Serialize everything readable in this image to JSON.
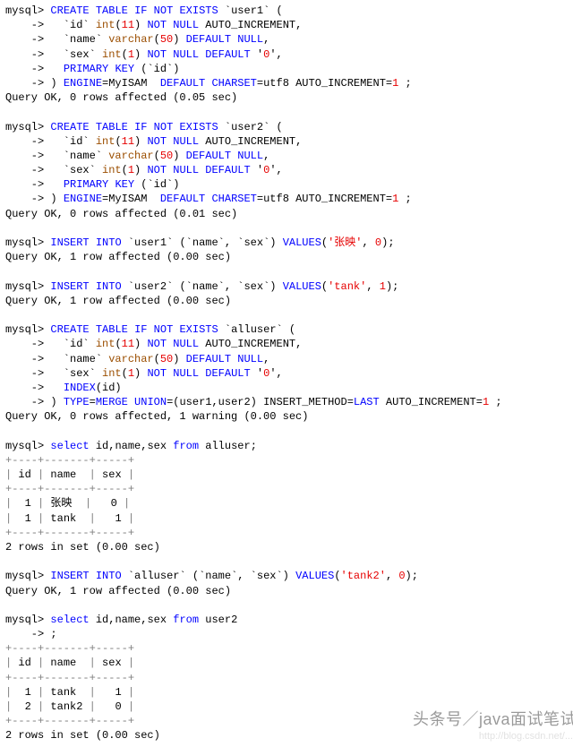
{
  "blocks": [
    {
      "id": "create_user1",
      "lines": [
        [
          "mysql> ",
          [
            "kw-blue",
            "CREATE"
          ],
          " ",
          [
            "kw-blue",
            "TABLE"
          ],
          " ",
          [
            "kw-blue",
            "IF"
          ],
          " ",
          [
            "kw-blue",
            "NOT"
          ],
          " ",
          [
            "kw-blue",
            "EXISTS"
          ],
          " `user1` ("
        ],
        [
          "    ->   `id` ",
          [
            "kw-brown",
            "int"
          ],
          "(",
          [
            "lit-red",
            "11"
          ],
          ") ",
          [
            "kw-blue",
            "NOT"
          ],
          " ",
          [
            "kw-blue",
            "NULL"
          ],
          " AUTO_INCREMENT,"
        ],
        [
          "    ->   `name` ",
          [
            "kw-brown",
            "varchar"
          ],
          "(",
          [
            "lit-red",
            "50"
          ],
          ") ",
          [
            "kw-blue",
            "DEFAULT"
          ],
          " ",
          [
            "kw-blue",
            "NULL"
          ],
          ","
        ],
        [
          "    ->   `sex` ",
          [
            "kw-brown",
            "int"
          ],
          "(",
          [
            "lit-red",
            "1"
          ],
          ") ",
          [
            "kw-blue",
            "NOT"
          ],
          " ",
          [
            "kw-blue",
            "NULL"
          ],
          " ",
          [
            "kw-blue",
            "DEFAULT"
          ],
          " '",
          [
            "lit-red",
            "0"
          ],
          "',"
        ],
        [
          "    ->   ",
          [
            "kw-blue",
            "PRIMARY"
          ],
          " ",
          [
            "kw-blue",
            "KEY"
          ],
          " (`id`)"
        ],
        [
          "    -> ) ",
          [
            "kw-blue",
            "ENGINE"
          ],
          "=MyISAM  ",
          [
            "kw-blue",
            "DEFAULT"
          ],
          " ",
          [
            "kw-blue",
            "CHARSET"
          ],
          "=utf8 AUTO_INCREMENT=",
          [
            "lit-red",
            "1"
          ],
          " ;"
        ],
        [
          "Query OK, 0 rows affected (0.05 sec)"
        ]
      ]
    },
    {
      "id": "create_user2",
      "lines": [
        [
          "mysql> ",
          [
            "kw-blue",
            "CREATE"
          ],
          " ",
          [
            "kw-blue",
            "TABLE"
          ],
          " ",
          [
            "kw-blue",
            "IF"
          ],
          " ",
          [
            "kw-blue",
            "NOT"
          ],
          " ",
          [
            "kw-blue",
            "EXISTS"
          ],
          " `user2` ("
        ],
        [
          "    ->   `id` ",
          [
            "kw-brown",
            "int"
          ],
          "(",
          [
            "lit-red",
            "11"
          ],
          ") ",
          [
            "kw-blue",
            "NOT"
          ],
          " ",
          [
            "kw-blue",
            "NULL"
          ],
          " AUTO_INCREMENT,"
        ],
        [
          "    ->   `name` ",
          [
            "kw-brown",
            "varchar"
          ],
          "(",
          [
            "lit-red",
            "50"
          ],
          ") ",
          [
            "kw-blue",
            "DEFAULT"
          ],
          " ",
          [
            "kw-blue",
            "NULL"
          ],
          ","
        ],
        [
          "    ->   `sex` ",
          [
            "kw-brown",
            "int"
          ],
          "(",
          [
            "lit-red",
            "1"
          ],
          ") ",
          [
            "kw-blue",
            "NOT"
          ],
          " ",
          [
            "kw-blue",
            "NULL"
          ],
          " ",
          [
            "kw-blue",
            "DEFAULT"
          ],
          " '",
          [
            "lit-red",
            "0"
          ],
          "',"
        ],
        [
          "    ->   ",
          [
            "kw-blue",
            "PRIMARY"
          ],
          " ",
          [
            "kw-blue",
            "KEY"
          ],
          " (`id`)"
        ],
        [
          "    -> ) ",
          [
            "kw-blue",
            "ENGINE"
          ],
          "=MyISAM  ",
          [
            "kw-blue",
            "DEFAULT"
          ],
          " ",
          [
            "kw-blue",
            "CHARSET"
          ],
          "=utf8 AUTO_INCREMENT=",
          [
            "lit-red",
            "1"
          ],
          " ;"
        ],
        [
          "Query OK, 0 rows affected (0.01 sec)"
        ]
      ]
    },
    {
      "id": "insert_user1",
      "lines": [
        [
          "mysql> ",
          [
            "kw-blue",
            "INSERT"
          ],
          " ",
          [
            "kw-blue",
            "INTO"
          ],
          " `user1` (`name`, `sex`) ",
          [
            "kw-blue",
            "VALUES"
          ],
          "(",
          [
            "lit-red",
            "'张映'"
          ],
          ", ",
          [
            "lit-red",
            "0"
          ],
          ");"
        ],
        [
          "Query OK, 1 row affected (0.00 sec)"
        ]
      ]
    },
    {
      "id": "insert_user2",
      "lines": [
        [
          "mysql> ",
          [
            "kw-blue",
            "INSERT"
          ],
          " ",
          [
            "kw-blue",
            "INTO"
          ],
          " `user2` (`name`, `sex`) ",
          [
            "kw-blue",
            "VALUES"
          ],
          "(",
          [
            "lit-red",
            "'tank'"
          ],
          ", ",
          [
            "lit-red",
            "1"
          ],
          ");"
        ],
        [
          "Query OK, 1 row affected (0.00 sec)"
        ]
      ]
    },
    {
      "id": "create_alluser",
      "lines": [
        [
          "mysql> ",
          [
            "kw-blue",
            "CREATE"
          ],
          " ",
          [
            "kw-blue",
            "TABLE"
          ],
          " ",
          [
            "kw-blue",
            "IF"
          ],
          " ",
          [
            "kw-blue",
            "NOT"
          ],
          " ",
          [
            "kw-blue",
            "EXISTS"
          ],
          " `alluser` ("
        ],
        [
          "    ->   `id` ",
          [
            "kw-brown",
            "int"
          ],
          "(",
          [
            "lit-red",
            "11"
          ],
          ") ",
          [
            "kw-blue",
            "NOT"
          ],
          " ",
          [
            "kw-blue",
            "NULL"
          ],
          " AUTO_INCREMENT,"
        ],
        [
          "    ->   `name` ",
          [
            "kw-brown",
            "varchar"
          ],
          "(",
          [
            "lit-red",
            "50"
          ],
          ") ",
          [
            "kw-blue",
            "DEFAULT"
          ],
          " ",
          [
            "kw-blue",
            "NULL"
          ],
          ","
        ],
        [
          "    ->   `sex` ",
          [
            "kw-brown",
            "int"
          ],
          "(",
          [
            "lit-red",
            "1"
          ],
          ") ",
          [
            "kw-blue",
            "NOT"
          ],
          " ",
          [
            "kw-blue",
            "NULL"
          ],
          " ",
          [
            "kw-blue",
            "DEFAULT"
          ],
          " '",
          [
            "lit-red",
            "0"
          ],
          "',"
        ],
        [
          "    ->   ",
          [
            "kw-blue",
            "INDEX"
          ],
          "(id)"
        ],
        [
          "    -> ) ",
          [
            "kw-blue",
            "TYPE"
          ],
          "=",
          [
            "kw-blue",
            "MERGE"
          ],
          " ",
          [
            "kw-blue",
            "UNION"
          ],
          "=(user1,user2) INSERT_METHOD=",
          [
            "kw-blue",
            "LAST"
          ],
          " AUTO_INCREMENT=",
          [
            "lit-red",
            "1"
          ],
          " ;"
        ],
        [
          "Query OK, 0 rows affected, 1 warning (0.00 sec)"
        ]
      ]
    },
    {
      "id": "select_alluser",
      "lines": [
        [
          "mysql> ",
          [
            "kw-blue",
            "select"
          ],
          " id,name,sex ",
          [
            "kw-blue",
            "from"
          ],
          " alluser;"
        ],
        [
          [
            "kw-grey",
            "+----+-------+-----+"
          ]
        ],
        [
          [
            "kw-grey",
            "|"
          ],
          " id ",
          [
            "kw-grey",
            "|"
          ],
          " name  ",
          [
            "kw-grey",
            "|"
          ],
          " sex ",
          [
            "kw-grey",
            "|"
          ]
        ],
        [
          [
            "kw-grey",
            "+----+-------+-----+"
          ]
        ],
        [
          [
            "kw-grey",
            "|"
          ],
          "  1 ",
          [
            "kw-grey",
            "|"
          ],
          " 张映  ",
          [
            "kw-grey",
            "|"
          ],
          "   0 ",
          [
            "kw-grey",
            "|"
          ]
        ],
        [
          [
            "kw-grey",
            "|"
          ],
          "  1 ",
          [
            "kw-grey",
            "|"
          ],
          " tank  ",
          [
            "kw-grey",
            "|"
          ],
          "   1 ",
          [
            "kw-grey",
            "|"
          ]
        ],
        [
          [
            "kw-grey",
            "+----+-------+-----+"
          ]
        ],
        [
          "2 rows in set (0.00 sec)"
        ]
      ]
    },
    {
      "id": "insert_alluser",
      "lines": [
        [
          "mysql> ",
          [
            "kw-blue",
            "INSERT"
          ],
          " ",
          [
            "kw-blue",
            "INTO"
          ],
          " `alluser` (`name`, `sex`) ",
          [
            "kw-blue",
            "VALUES"
          ],
          "(",
          [
            "lit-red",
            "'tank2'"
          ],
          ", ",
          [
            "lit-red",
            "0"
          ],
          ");"
        ],
        [
          "Query OK, 1 row affected (0.00 sec)"
        ]
      ]
    },
    {
      "id": "select_user2",
      "lines": [
        [
          "mysql> ",
          [
            "kw-blue",
            "select"
          ],
          " id,name,sex ",
          [
            "kw-blue",
            "from"
          ],
          " user2"
        ],
        [
          "    -> ;"
        ],
        [
          [
            "kw-grey",
            "+----+-------+-----+"
          ]
        ],
        [
          [
            "kw-grey",
            "|"
          ],
          " id ",
          [
            "kw-grey",
            "|"
          ],
          " name  ",
          [
            "kw-grey",
            "|"
          ],
          " sex ",
          [
            "kw-grey",
            "|"
          ]
        ],
        [
          [
            "kw-grey",
            "+----+-------+-----+"
          ]
        ],
        [
          [
            "kw-grey",
            "|"
          ],
          "  1 ",
          [
            "kw-grey",
            "|"
          ],
          " tank  ",
          [
            "kw-grey",
            "|"
          ],
          "   1 ",
          [
            "kw-grey",
            "|"
          ]
        ],
        [
          [
            "kw-grey",
            "|"
          ],
          "  2 ",
          [
            "kw-grey",
            "|"
          ],
          " tank2 ",
          [
            "kw-grey",
            "|"
          ],
          "   0 ",
          [
            "kw-grey",
            "|"
          ]
        ],
        [
          [
            "kw-grey",
            "+----+-------+-----+"
          ]
        ],
        [
          "2 rows in set (0.00 sec)"
        ]
      ]
    }
  ],
  "result_tables": {
    "alluser": {
      "columns": [
        "id",
        "name",
        "sex"
      ],
      "rows": [
        {
          "id": 1,
          "name": "张映",
          "sex": 0
        },
        {
          "id": 1,
          "name": "tank",
          "sex": 1
        }
      ],
      "row_count_text": "2 rows in set (0.00 sec)"
    },
    "user2": {
      "columns": [
        "id",
        "name",
        "sex"
      ],
      "rows": [
        {
          "id": 1,
          "name": "tank",
          "sex": 1
        },
        {
          "id": 2,
          "name": "tank2",
          "sex": 0
        }
      ],
      "row_count_text": "2 rows in set (0.00 sec)"
    }
  },
  "watermark_main": "头条号／java面试笔试",
  "watermark_sub": "http://blog.csdn.net/..."
}
